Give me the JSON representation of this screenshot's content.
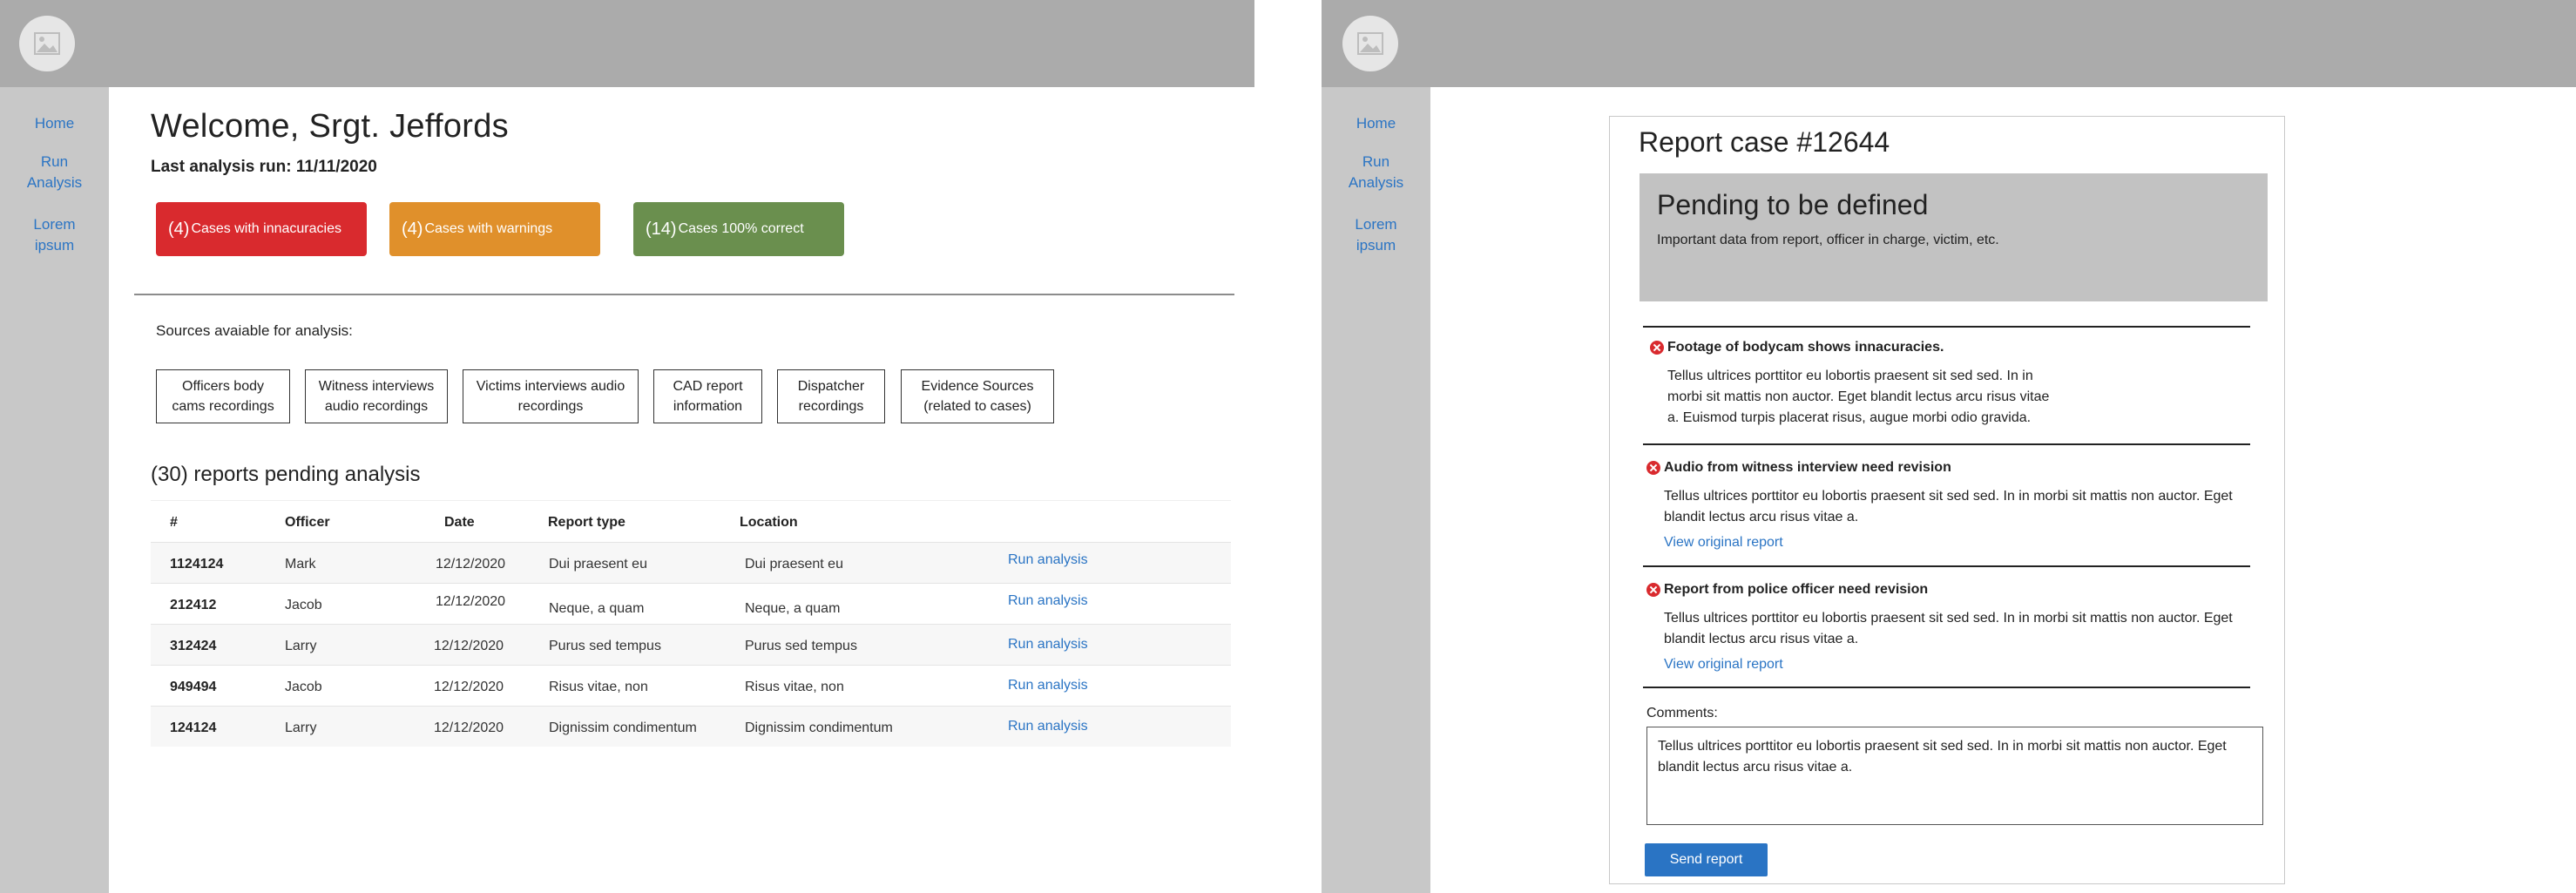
{
  "left": {
    "sidebar": {
      "home": "Home",
      "run_analysis_1": "Run",
      "run_analysis_2": "Analysis",
      "lorem_1": "Lorem",
      "lorem_2": "ipsum"
    },
    "welcome": "Welcome, Srgt. Jeffords",
    "last_run": "Last analysis run: 11/11/2020",
    "cards": [
      {
        "count": "(4)",
        "label": "Cases with innacuracies",
        "color": "#d92a2e"
      },
      {
        "count": "(4)",
        "label": "Cases with warnings",
        "color": "#e0902b"
      },
      {
        "count": "(14)",
        "label": "Cases 100% correct",
        "color": "#6a8f4e"
      }
    ],
    "sources_title": "Sources avaiable for analysis:",
    "sources": [
      {
        "line1": "Officers body",
        "line2": "cams recordings"
      },
      {
        "line1": "Witness interviews",
        "line2": "audio recordings"
      },
      {
        "line1": "Victims interviews audio",
        "line2": "recordings"
      },
      {
        "line1": "CAD report",
        "line2": "information"
      },
      {
        "line1": "Dispatcher",
        "line2": "recordings"
      },
      {
        "line1": "Evidence Sources",
        "line2": "(related to cases)"
      }
    ],
    "pending_title": "(30) reports pending analysis",
    "table": {
      "headers": [
        "#",
        "Officer",
        "Date",
        "Report type",
        "Location"
      ],
      "rows": [
        {
          "id": "1124124",
          "officer": "Mark",
          "date": "12/12/2020",
          "type": "Dui praesent eu",
          "location": "Dui praesent eu",
          "action": "Run analysis"
        },
        {
          "id": "212412",
          "officer": "Jacob",
          "date": "12/12/2020",
          "type": "Neque, a quam",
          "location": "Neque, a quam",
          "action": "Run analysis"
        },
        {
          "id": "312424",
          "officer": "Larry",
          "date": "12/12/2020",
          "type": "Purus sed tempus",
          "location": "Purus sed tempus",
          "action": "Run analysis"
        },
        {
          "id": "949494",
          "officer": "Jacob",
          "date": "12/12/2020",
          "type": "Risus vitae, non",
          "location": "Risus vitae, non",
          "action": "Run analysis"
        },
        {
          "id": "124124",
          "officer": "Larry",
          "date": "12/12/2020",
          "type": "Dignissim condimentum",
          "location": "Dignissim condimentum",
          "action": "Run analysis"
        }
      ]
    }
  },
  "right": {
    "sidebar": {
      "home": "Home",
      "run_analysis_1": "Run",
      "run_analysis_2": "Analysis",
      "lorem_1": "Lorem",
      "lorem_2": "ipsum"
    },
    "report_title": "Report case #12644",
    "pending_box_title": "Pending to be defined",
    "pending_box_sub": "Important data from report, officer in charge, victim, etc.",
    "issues": [
      {
        "title": "Footage of bodycam shows innacuracies.",
        "body_lines": [
          "Tellus ultrices porttitor eu lobortis praesent sit sed sed. In in",
          "morbi sit mattis non auctor. Eget blandit lectus arcu risus vitae",
          "a. Euismod turpis placerat risus, augue morbi odio gravida."
        ],
        "link": ""
      },
      {
        "title": "Audio from witness interview need revision",
        "body_lines": [
          "Tellus ultrices porttitor eu lobortis praesent sit sed sed. In in morbi sit mattis non auctor. Eget",
          "blandit lectus arcu risus vitae a."
        ],
        "link": "View original report"
      },
      {
        "title": "Report from police officer need revision",
        "body_lines": [
          "Tellus ultrices porttitor eu lobortis praesent sit sed sed. In in morbi sit mattis non auctor. Eget",
          "blandit lectus arcu risus vitae a."
        ],
        "link": "View original report"
      }
    ],
    "comments_label": "Comments:",
    "comments_value": "Tellus ultrices porttitor eu lobortis praesent sit sed sed. In in morbi sit mattis non auctor. Eget blandit lectus arcu risus vitae a.",
    "send_label": "Send report"
  },
  "colors": {
    "accent": "#2a74c4",
    "error": "#d92a2e",
    "warning": "#e0902b",
    "success": "#6a8f4e",
    "topbar": "#ababab",
    "sidebar": "#c8c8c8"
  },
  "icons": [
    "image-placeholder-icon",
    "error-x-icon"
  ]
}
